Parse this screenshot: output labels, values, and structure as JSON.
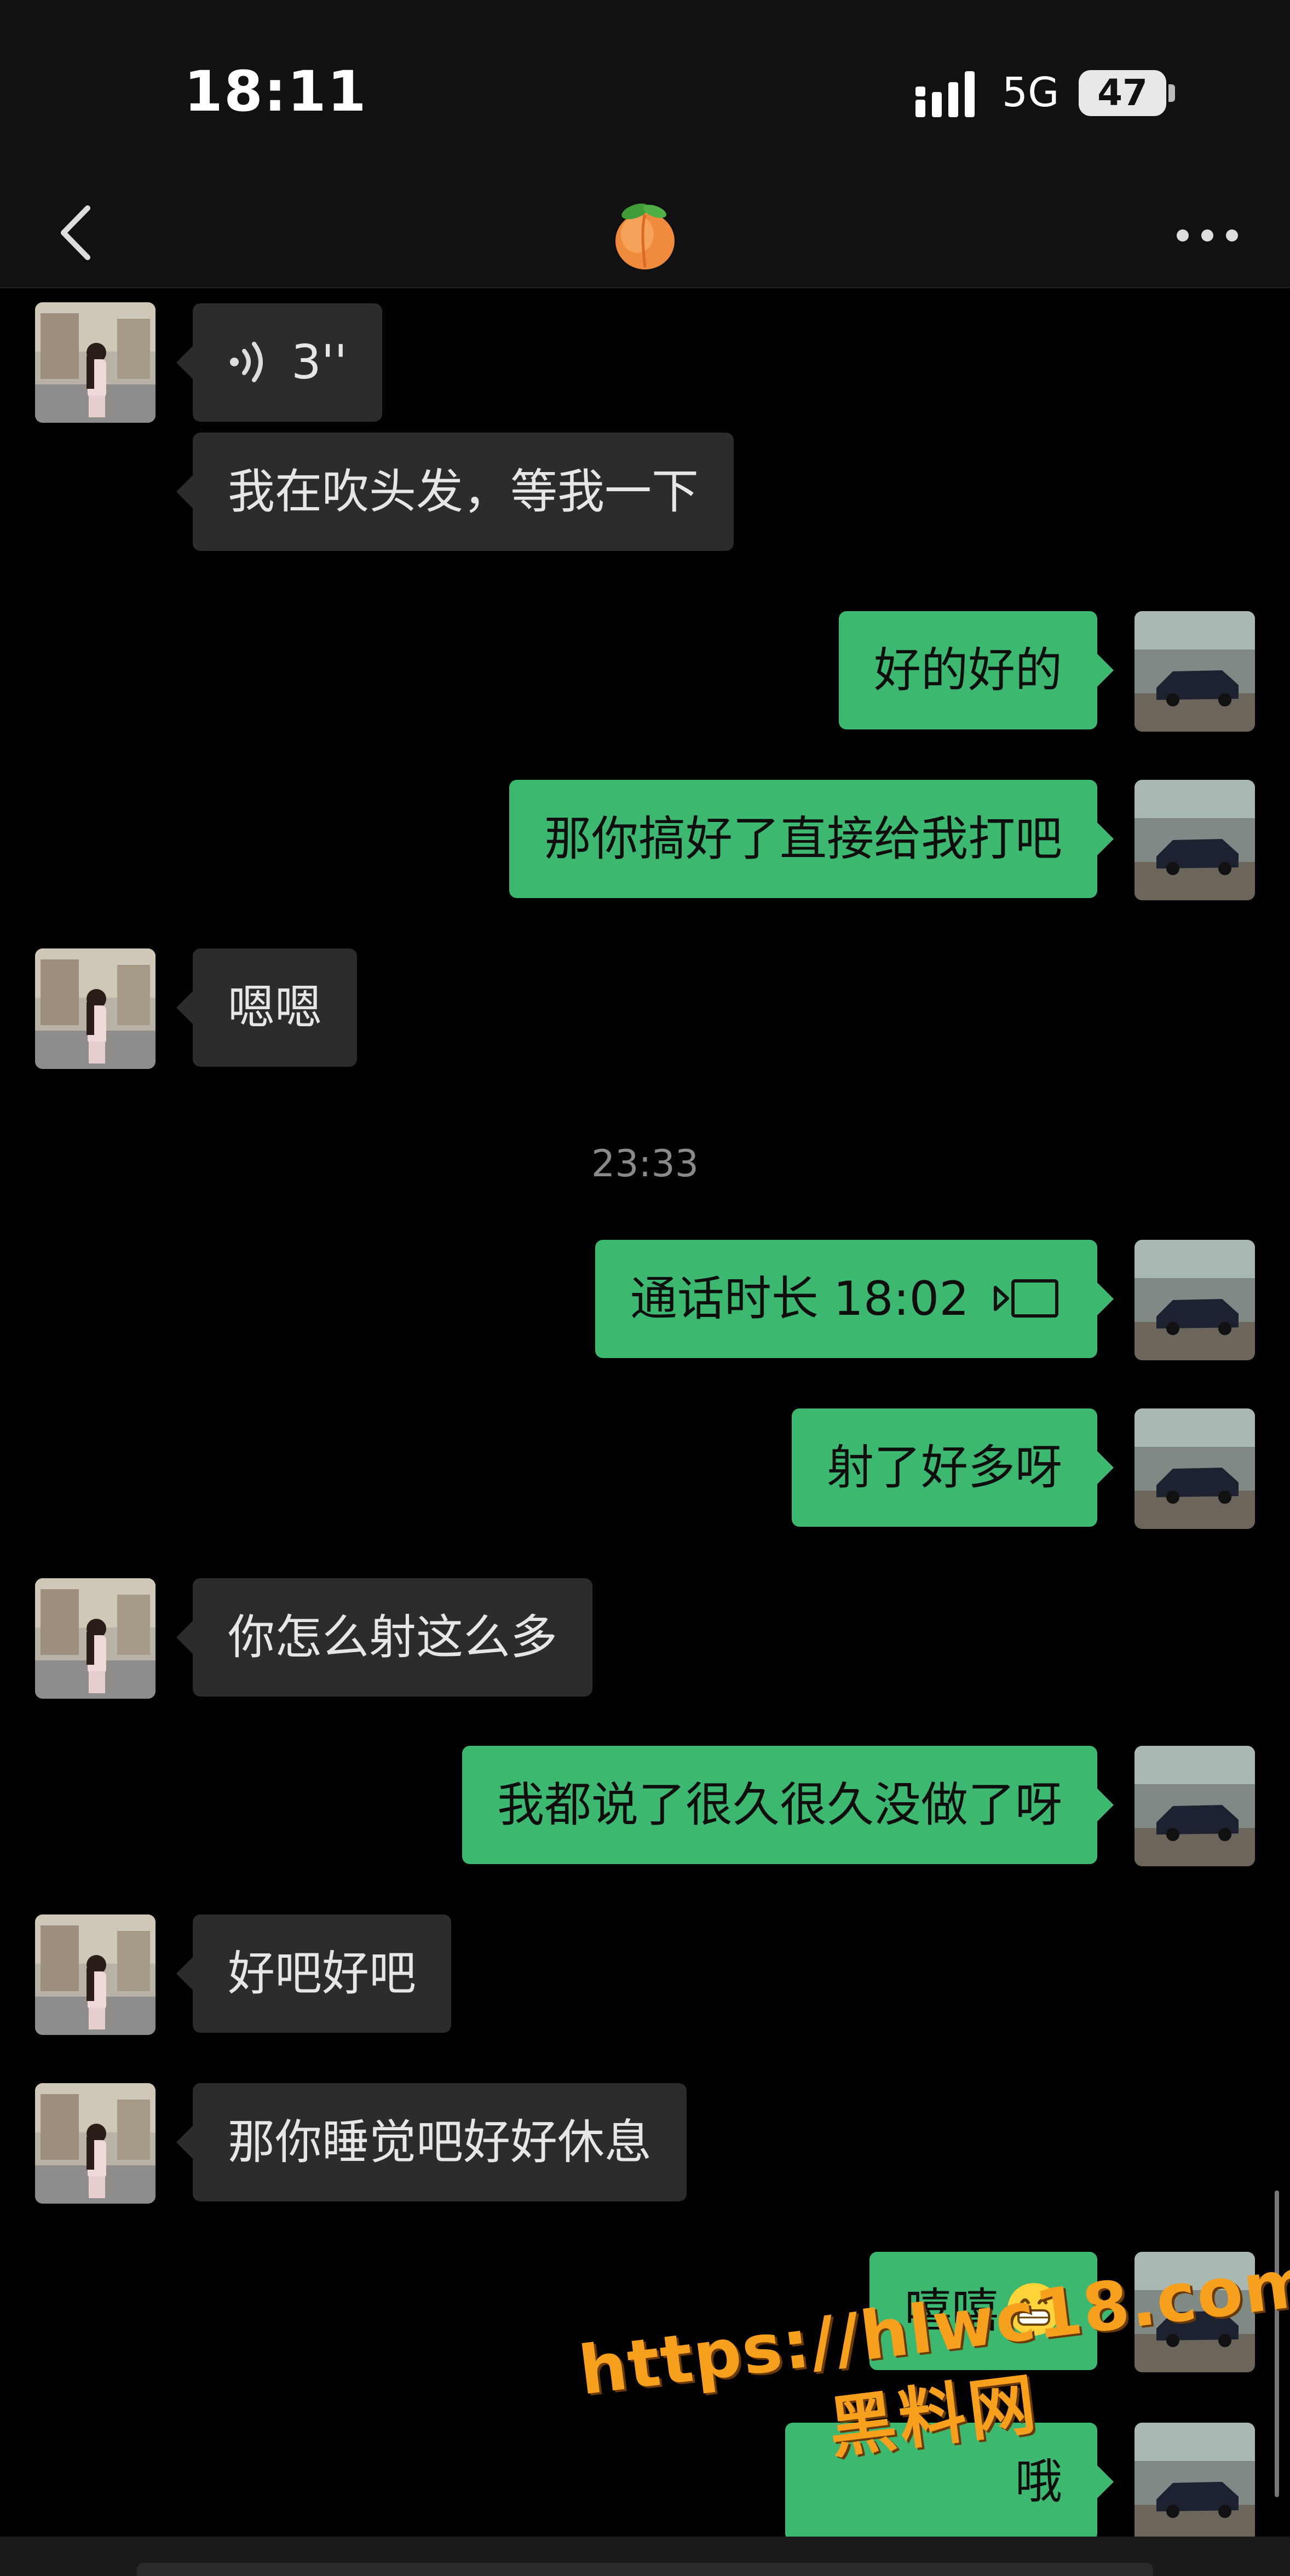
{
  "status_bar": {
    "time": "18:11",
    "network": "5G",
    "battery": "47"
  },
  "nav": {
    "title_emoji": "peach",
    "back_icon": "chevron-left-icon",
    "more_icon": "more-icon"
  },
  "messages": [
    {
      "sender": "other",
      "type": "voice",
      "text": "3''"
    },
    {
      "sender": "other",
      "type": "text",
      "text": "我在吹头发，等我一下"
    },
    {
      "sender": "me",
      "type": "text",
      "text": "好的好的"
    },
    {
      "sender": "me",
      "type": "text",
      "text": "那你搞好了直接给我打吧"
    },
    {
      "sender": "other",
      "type": "text",
      "text": "嗯嗯"
    },
    {
      "sender": "system",
      "type": "time",
      "text": "23:33"
    },
    {
      "sender": "me",
      "type": "call",
      "text": "通话时长 18:02"
    },
    {
      "sender": "me",
      "type": "text",
      "text": "射了好多呀"
    },
    {
      "sender": "other",
      "type": "text",
      "text": "你怎么射这么多"
    },
    {
      "sender": "me",
      "type": "text",
      "text": "我都说了很久很久没做了呀"
    },
    {
      "sender": "other",
      "type": "text",
      "text": "好吧好吧"
    },
    {
      "sender": "other",
      "type": "text",
      "text": "那你睡觉吧好好休息"
    },
    {
      "sender": "me",
      "type": "text",
      "text": "嘻嘻",
      "emoji": "grin"
    },
    {
      "sender": "me",
      "type": "text",
      "text": "哦"
    }
  ],
  "watermark": {
    "url": "https://hlwc18.com",
    "text": "黑料网"
  },
  "colors": {
    "outgoing_bubble": "#3cb870",
    "incoming_bubble": "#2c2c2c",
    "background": "#000000",
    "watermark": "#f6a01e"
  }
}
